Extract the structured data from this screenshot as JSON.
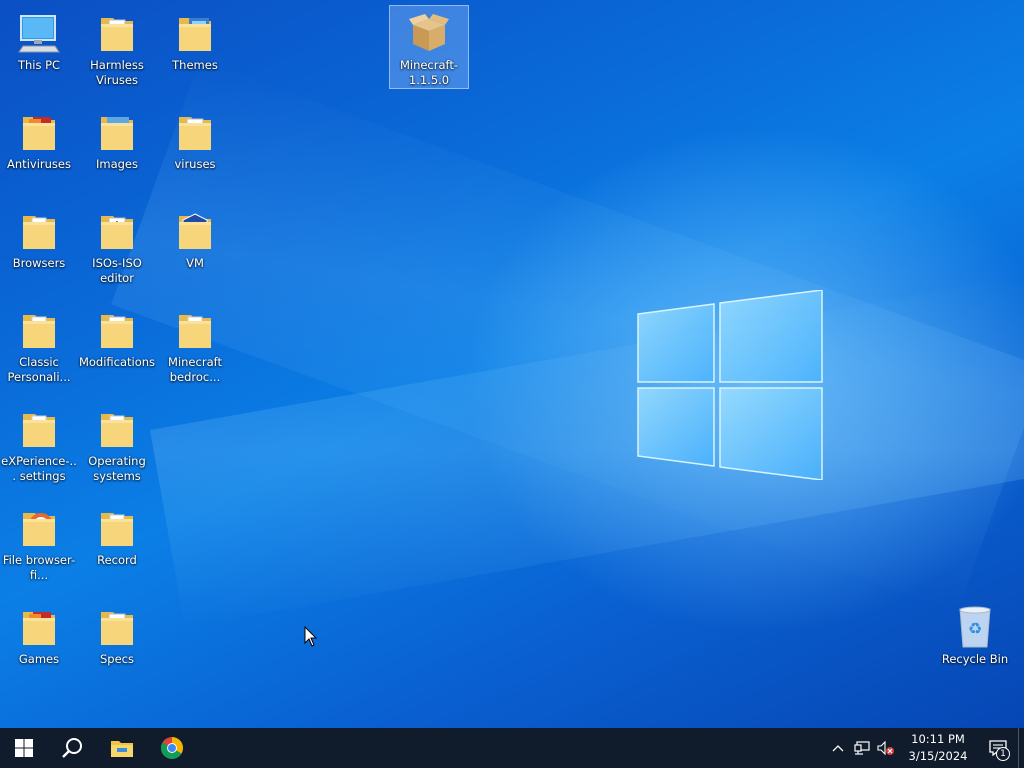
{
  "desktop": {
    "icons": [
      {
        "id": "this-pc",
        "label": "This PC",
        "type": "pc"
      },
      {
        "id": "harmless-viruses",
        "label": "Harmless Viruses",
        "type": "folder-doc"
      },
      {
        "id": "themes",
        "label": "Themes",
        "type": "folder-blue"
      },
      {
        "id": "minecraft",
        "label": "Minecraft-1.1.5.0",
        "type": "package"
      },
      {
        "id": "antiviruses",
        "label": "Antiviruses",
        "type": "folder-red"
      },
      {
        "id": "images",
        "label": "Images",
        "type": "folder-image"
      },
      {
        "id": "viruses",
        "label": "viruses",
        "type": "folder-docx"
      },
      {
        "id": "browsers",
        "label": "Browsers",
        "type": "folder"
      },
      {
        "id": "isos",
        "label": "ISOs-ISO editor",
        "type": "folder-download"
      },
      {
        "id": "vm",
        "label": "VM",
        "type": "folder-vm"
      },
      {
        "id": "classic-personalization",
        "label": "Classic Personali...",
        "type": "folder"
      },
      {
        "id": "modifications",
        "label": "Modifications",
        "type": "folder-doc"
      },
      {
        "id": "minecraft-bedrock",
        "label": "Minecraft bedroc...",
        "type": "folder"
      },
      {
        "id": "experience-settings",
        "label": "eXPerience-... settings",
        "type": "folder"
      },
      {
        "id": "operating-systems",
        "label": "Operating systems",
        "type": "folder"
      },
      {
        "id": "file-browser",
        "label": "File browser-fi...",
        "type": "folder-orange"
      },
      {
        "id": "record",
        "label": "Record",
        "type": "folder"
      },
      {
        "id": "games",
        "label": "Games",
        "type": "folder-red"
      },
      {
        "id": "specs",
        "label": "Specs",
        "type": "folder-doc"
      },
      {
        "id": "recycle-bin",
        "label": "Recycle Bin",
        "type": "recycle"
      }
    ]
  },
  "taskbar": {
    "pinned": [
      {
        "id": "start",
        "icon": "windows-icon"
      },
      {
        "id": "search",
        "icon": "search-icon"
      },
      {
        "id": "file-explorer",
        "icon": "folder-icon"
      },
      {
        "id": "chrome",
        "icon": "chrome-icon"
      }
    ],
    "clock": {
      "time": "10:11 PM",
      "date": "3/15/2024"
    },
    "notifications": {
      "count": "1"
    }
  },
  "colors": {
    "taskbar": "#101c2c",
    "folder": "#f3d27a",
    "accent": "#1c7ce8"
  }
}
